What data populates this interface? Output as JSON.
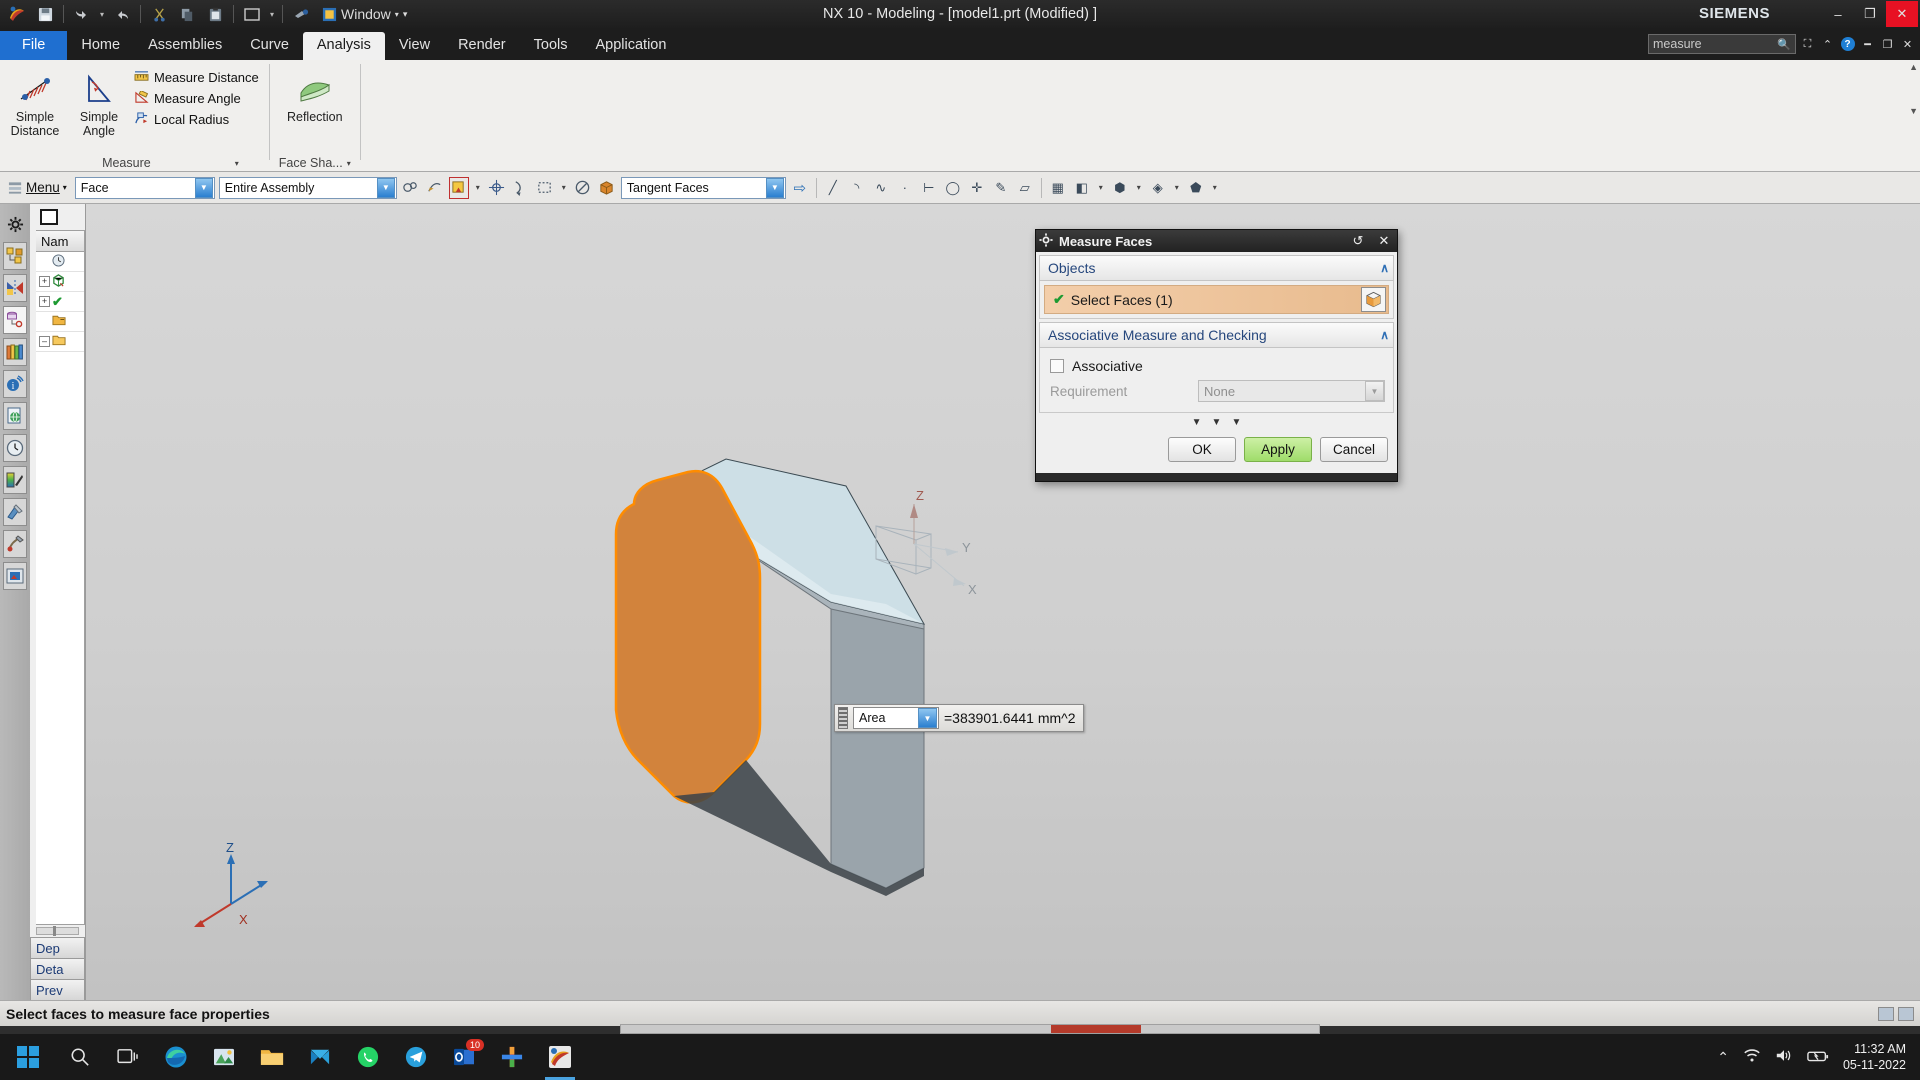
{
  "titlebar": {
    "title": "NX 10 - Modeling - [model1.prt (Modified) ]",
    "brand": "SIEMENS",
    "window_menu": "Window",
    "qat": [
      {
        "name": "nx-logo-icon",
        "glyph": "✦"
      },
      {
        "name": "save-icon",
        "glyph": "💾"
      },
      {
        "name": "undo-icon",
        "glyph": "↶"
      },
      {
        "name": "redo-icon",
        "glyph": "↷"
      },
      {
        "name": "cut-icon",
        "glyph": "✂"
      },
      {
        "name": "copy-icon",
        "glyph": "❐"
      },
      {
        "name": "paste-icon",
        "glyph": "📋"
      },
      {
        "name": "window-layout-icon",
        "glyph": "▭"
      },
      {
        "name": "format-painter-icon",
        "glyph": "🖌"
      }
    ],
    "buttons": [
      {
        "name": "minimize-button",
        "glyph": "–"
      },
      {
        "name": "restore-button",
        "glyph": "❐"
      },
      {
        "name": "close-button",
        "glyph": "✕"
      }
    ]
  },
  "tabs": [
    {
      "label": "File",
      "kind": "file"
    },
    {
      "label": "Home",
      "kind": "normal"
    },
    {
      "label": "Assemblies",
      "kind": "normal"
    },
    {
      "label": "Curve",
      "kind": "normal"
    },
    {
      "label": "Analysis",
      "kind": "active"
    },
    {
      "label": "View",
      "kind": "normal"
    },
    {
      "label": "Render",
      "kind": "normal"
    },
    {
      "label": "Tools",
      "kind": "normal"
    },
    {
      "label": "Application",
      "kind": "normal"
    }
  ],
  "search": {
    "value": "measure",
    "placeholder": "Command Finder"
  },
  "ribbon": {
    "measure_group": {
      "label": "Measure",
      "big_buttons": [
        {
          "label_line1": "Simple",
          "label_line2": "Distance",
          "icon": "simple-distance-icon"
        },
        {
          "label_line1": "Simple",
          "label_line2": "Angle",
          "icon": "simple-angle-icon"
        }
      ],
      "small_buttons": [
        {
          "label": "Measure Distance",
          "icon": "measure-distance-icon"
        },
        {
          "label": "Measure Angle",
          "icon": "measure-angle-icon"
        },
        {
          "label": "Local Radius",
          "icon": "local-radius-icon"
        }
      ]
    },
    "face_shape_group": {
      "label": "Face Sha...",
      "buttons": [
        {
          "label": "Reflection",
          "icon": "reflection-icon"
        }
      ]
    }
  },
  "selection_bar": {
    "menu_label": "Menu",
    "type_filter": {
      "value": "Face"
    },
    "scope_filter": {
      "value": "Entire Assembly"
    },
    "tangent_filter": {
      "value": "Tangent Faces"
    },
    "icons": [
      {
        "name": "snap-point-icon",
        "glyph": "⚭"
      },
      {
        "name": "curve-rule-icon",
        "glyph": "⤳"
      },
      {
        "name": "face-rule-icon",
        "glyph": "⬚",
        "framed": true
      },
      {
        "name": "snap-center-icon",
        "glyph": "⊕"
      },
      {
        "name": "curve-select-icon",
        "glyph": "⤵"
      },
      {
        "name": "rectangle-select-icon",
        "glyph": "⬚"
      },
      {
        "name": "no-select-icon",
        "glyph": "⊘"
      },
      {
        "name": "solid-body-icon",
        "glyph": "⬛"
      }
    ],
    "end_icon": {
      "name": "next-arrow-icon",
      "glyph": "⇨"
    }
  },
  "resource_bar": {
    "gear_icon": "settings-gear-icon",
    "items": [
      {
        "name": "assembly-navigator-icon",
        "glyph": "◰"
      },
      {
        "name": "constraint-navigator-icon",
        "glyph": "▶"
      },
      {
        "name": "part-navigator-icon",
        "glyph": "⛁"
      },
      {
        "name": "reuse-library-icon",
        "glyph": "▤"
      },
      {
        "name": "hd3d-tools-icon",
        "glyph": "ⓘ"
      },
      {
        "name": "web-browser-icon",
        "glyph": "☷"
      },
      {
        "name": "history-icon",
        "glyph": "◴"
      },
      {
        "name": "system-scene-icon",
        "glyph": "▨"
      },
      {
        "name": "system-materials-icon",
        "glyph": "⚒"
      },
      {
        "name": "system-visual-icon",
        "glyph": "⚒"
      },
      {
        "name": "roles-icon",
        "glyph": "▣"
      }
    ]
  },
  "nav_panel": {
    "column_header": "Nam",
    "rows": [
      {
        "icon": "timestamp-icon",
        "glyph": "◴",
        "expander": ""
      },
      {
        "icon": "model-views-icon",
        "glyph": "⬡",
        "expander": "+"
      },
      {
        "icon": "cameras-icon",
        "glyph": "✔",
        "expander": "+"
      },
      {
        "icon": "model-history-folder-icon",
        "glyph": "📁",
        "expander": ""
      },
      {
        "icon": "folder-icon",
        "glyph": "📂",
        "expander": "–"
      }
    ],
    "tabs": [
      {
        "label": "Dep"
      },
      {
        "label": "Deta"
      },
      {
        "label": "Prev"
      }
    ]
  },
  "graphics": {
    "triad": {
      "z_label": "Z",
      "x_label": "X",
      "y_label": "Y"
    },
    "model_triad": {
      "z_label": "Z",
      "x_label": "X",
      "y_label": "Y"
    },
    "callout": {
      "measure_type": "Area",
      "value": "=383901.6441 mm^2"
    },
    "colors": {
      "selected_face": "#d2833c",
      "selected_edge": "#ff8c00",
      "top_face": "#ccdde4",
      "side_face": "#8f9ba3",
      "background_top": "#d7d7d7",
      "background_bottom": "#c2c2c2"
    }
  },
  "dialog": {
    "title": "Measure Faces",
    "title_buttons": [
      {
        "name": "reset-button",
        "glyph": "↺"
      },
      {
        "name": "close-dialog-button",
        "glyph": "✕"
      }
    ],
    "sections": [
      {
        "label": "Objects",
        "chevron": "∧"
      },
      {
        "label": "Associative Measure and Checking",
        "chevron": "∧"
      }
    ],
    "select_faces": {
      "label": "Select Faces (1)",
      "check": "✔",
      "icon": "select-face-cube-icon"
    },
    "associative": {
      "label": "Associative",
      "checked": false
    },
    "requirement": {
      "label": "Requirement",
      "value": "None"
    },
    "more_chevrons": "∨ ∨ ∨",
    "buttons": [
      {
        "label": "OK",
        "kind": "normal"
      },
      {
        "label": "Apply",
        "kind": "apply"
      },
      {
        "label": "Cancel",
        "kind": "normal"
      }
    ]
  },
  "statusbar": {
    "message": "Select faces to measure face properties"
  },
  "taskbar": {
    "start_icon": "windows-start-icon",
    "items": [
      {
        "name": "search-icon",
        "glyph": "🔍",
        "badge": ""
      },
      {
        "name": "task-view-icon",
        "glyph": "▭",
        "badge": ""
      },
      {
        "name": "edge-browser-icon",
        "glyph": "◐",
        "badge": ""
      },
      {
        "name": "photos-icon",
        "glyph": "🖼",
        "badge": ""
      },
      {
        "name": "file-explorer-icon",
        "glyph": "📁",
        "badge": ""
      },
      {
        "name": "mail-icon",
        "glyph": "✉",
        "badge": ""
      },
      {
        "name": "whatsapp-icon",
        "glyph": "✆",
        "badge": ""
      },
      {
        "name": "telegram-icon",
        "glyph": "➤",
        "badge": ""
      },
      {
        "name": "outlook-icon",
        "glyph": "✉",
        "badge": "10"
      },
      {
        "name": "office-icon",
        "glyph": "✚",
        "badge": ""
      },
      {
        "name": "nx-app-icon",
        "glyph": "✦",
        "badge": ""
      }
    ],
    "tray": [
      {
        "name": "show-hidden-icons-icon",
        "glyph": "∧"
      },
      {
        "name": "wifi-icon",
        "glyph": "◠"
      },
      {
        "name": "volume-icon",
        "glyph": "🔊"
      },
      {
        "name": "battery-icon",
        "glyph": "▭"
      }
    ],
    "clock": {
      "time": "11:32 AM",
      "date": "05-11-2022"
    }
  }
}
